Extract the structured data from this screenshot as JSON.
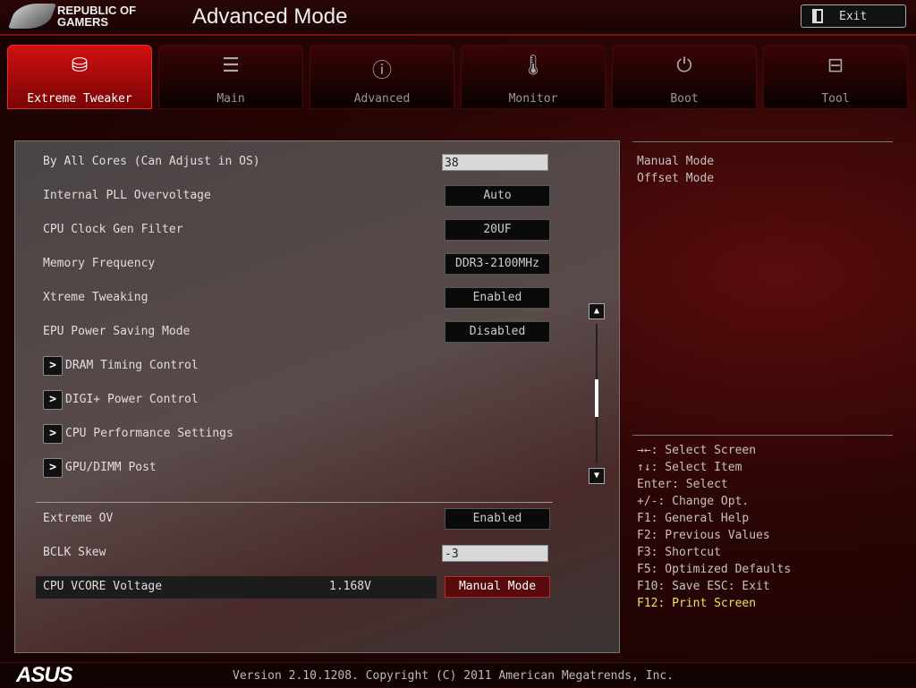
{
  "header": {
    "logo_line1": "REPUBLIC OF",
    "logo_line2": "GAMERS",
    "title": "Advanced Mode",
    "exit_label": "Exit"
  },
  "tabs": [
    {
      "label": "Extreme Tweaker",
      "icon": "tweaker-icon",
      "active": true
    },
    {
      "label": "Main",
      "icon": "list-icon"
    },
    {
      "label": "Advanced",
      "icon": "advanced-info-icon"
    },
    {
      "label": "Monitor",
      "icon": "thermometer-icon"
    },
    {
      "label": "Boot",
      "icon": "power-icon"
    },
    {
      "label": "Tool",
      "icon": "toolbox-icon"
    }
  ],
  "settings": [
    {
      "label": "By All Cores (Can Adjust in OS)",
      "type": "input",
      "value": "38"
    },
    {
      "label": "Internal PLL Overvoltage",
      "type": "select",
      "value": "Auto"
    },
    {
      "label": "CPU Clock Gen Filter",
      "type": "select",
      "value": "20UF"
    },
    {
      "label": "Memory Frequency",
      "type": "select",
      "value": "DDR3-2100MHz"
    },
    {
      "label": "Xtreme Tweaking",
      "type": "select",
      "value": "Enabled"
    },
    {
      "label": "EPU Power Saving Mode",
      "type": "select",
      "value": "Disabled"
    },
    {
      "label": "DRAM Timing Control",
      "type": "submenu"
    },
    {
      "label": "DIGI+ Power Control",
      "type": "submenu"
    },
    {
      "label": "CPU Performance Settings",
      "type": "submenu"
    },
    {
      "label": "GPU/DIMM Post",
      "type": "submenu"
    }
  ],
  "lower_settings": [
    {
      "label": "Extreme OV",
      "type": "select",
      "value": "Enabled"
    },
    {
      "label": "BCLK Skew",
      "type": "input",
      "value": "-3"
    },
    {
      "label": "CPU VCORE Voltage",
      "type": "select",
      "value": "Manual Mode",
      "reading": "1.168V",
      "selected": true
    }
  ],
  "scroll_position_percent": 45,
  "help": {
    "options": [
      "Manual Mode",
      "Offset Mode"
    ],
    "keys": [
      "→←: Select Screen",
      "↑↓: Select Item",
      "Enter: Select",
      "+/-: Change Opt.",
      "F1: General Help",
      "F2: Previous Values",
      "F3: Shortcut",
      "F5: Optimized Defaults",
      "F10: Save  ESC: Exit",
      "F12: Print Screen"
    ]
  },
  "footer": {
    "brand": "ASUS",
    "version": "Version 2.10.1208. Copyright (C) 2011 American Megatrends, Inc."
  },
  "colors": {
    "accent": "#d01010",
    "highlight_key": "#f0e060",
    "selected_value_bg": "#5a0a0a"
  }
}
